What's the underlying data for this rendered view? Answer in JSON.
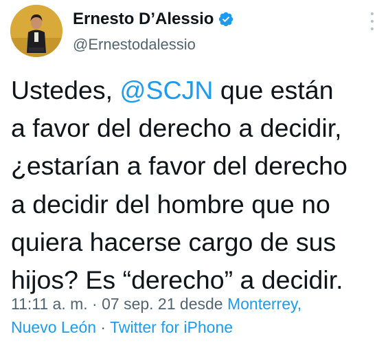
{
  "author": {
    "display_name": "Ernesto D’Alessio",
    "handle": "@Ernestodalessio",
    "verified_icon": "verified-badge-icon",
    "avatar": "avatar-photo"
  },
  "more_icon": "more-options-icon",
  "tweet": {
    "line1_pre": "Ustedes, ",
    "mention": "@SCJN",
    "line1_post": " que están",
    "line2": "a favor del derecho a decidir,",
    "line3": "¿estarían a favor del derecho",
    "line4": "a decidir del hombre que no",
    "line5": "quiera hacerse cargo de sus",
    "line6": "hijos? Es “derecho” a decidir."
  },
  "meta": {
    "timestamp": "11:11 a. m. · 07 sep. 21 desde ",
    "location_part1": "Monterrey,",
    "location_part2": "Nuevo León",
    "separator": " · ",
    "client": "Twitter for iPhone"
  },
  "colors": {
    "link": "#1d9bf0",
    "text": "#0f1419",
    "muted": "#536471",
    "avatar_bg": "#d9a93a"
  }
}
